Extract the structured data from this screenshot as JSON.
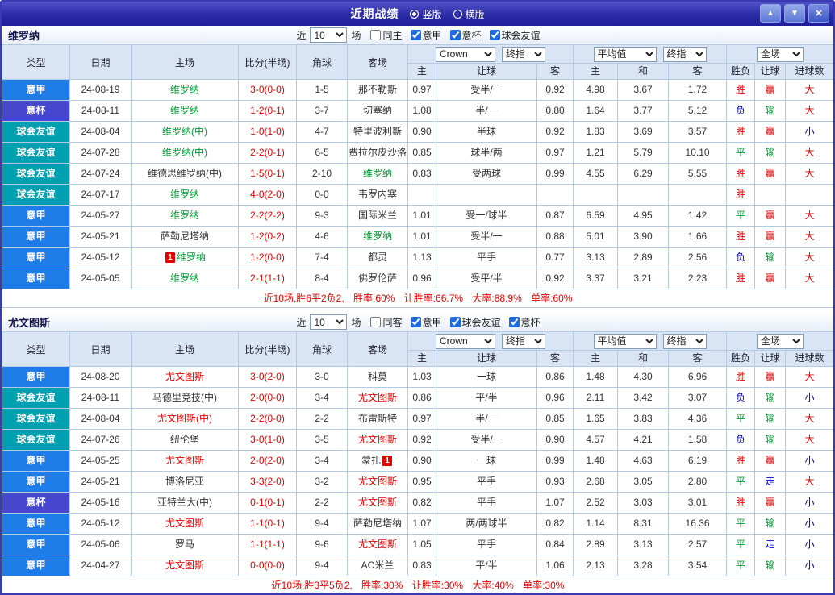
{
  "titlebar": {
    "title": "近期战绩",
    "radio_vertical": "竖版",
    "radio_horizontal": "横版"
  },
  "icons": {
    "up": "▲",
    "down": "▼",
    "close": "×"
  },
  "league_colors": {
    "意甲": "#1e7ce8",
    "意杯": "#4646cf",
    "球会友谊": "#00a0b0"
  },
  "result_colors": {
    "胜": "#e60000",
    "赢": "#e60000",
    "大": "#e60000",
    "平": "#009933",
    "输": "#009933",
    "负": "#0000cc",
    "走": "#0000cc",
    "小": "#0000cc"
  },
  "score_color": "#e60000",
  "header": {
    "near": "近",
    "count": "10",
    "matches": "场",
    "bookmaker_select": "Crown",
    "final_select_1": "终指",
    "average_select": "平均值",
    "final_select_2": "终指",
    "scope_select": "全场",
    "type": "类型",
    "date": "日期",
    "home": "主场",
    "score": "比分(半场)",
    "corner": "角球",
    "away": "客场",
    "odds_home": "主",
    "handicap": "让球",
    "odds_away": "客",
    "avg_home": "主",
    "avg_draw": "和",
    "avg_away": "客",
    "result": "胜负",
    "handicap_result": "让球",
    "goals": "进球数"
  },
  "sections": [
    {
      "team": "维罗纳",
      "subject_color": "#009933",
      "same_filter": "同主",
      "leagues": [
        "意甲",
        "意杯",
        "球会友谊"
      ],
      "rows": [
        {
          "type": "意甲",
          "date": "24-08-19",
          "home": "维罗纳",
          "home_subject": true,
          "away": "那不勒斯",
          "score": "3-0(0-0)",
          "corner": "1-5",
          "odds_home": "0.97",
          "handicap": "受半/一",
          "odds_away": "0.92",
          "avg_home": "4.98",
          "avg_draw": "3.67",
          "avg_away": "1.72",
          "result": "胜",
          "handicap_result": "赢",
          "goals": "大"
        },
        {
          "type": "意杯",
          "date": "24-08-11",
          "home": "维罗纳",
          "home_subject": true,
          "away": "切塞纳",
          "score": "1-2(0-1)",
          "corner": "3-7",
          "odds_home": "1.08",
          "handicap": "半/一",
          "odds_away": "0.80",
          "avg_home": "1.64",
          "avg_draw": "3.77",
          "avg_away": "5.12",
          "result": "负",
          "handicap_result": "输",
          "goals": "大"
        },
        {
          "type": "球会友谊",
          "date": "24-08-04",
          "home": "维罗纳(中)",
          "home_subject": true,
          "away": "特里波利斯",
          "score": "1-0(1-0)",
          "corner": "4-7",
          "odds_home": "0.90",
          "handicap": "半球",
          "odds_away": "0.92",
          "avg_home": "1.83",
          "avg_draw": "3.69",
          "avg_away": "3.57",
          "result": "胜",
          "handicap_result": "赢",
          "goals": "小"
        },
        {
          "type": "球会友谊",
          "date": "24-07-28",
          "home": "维罗纳(中)",
          "home_subject": true,
          "away": "费拉尔皮沙洛",
          "score": "2-2(0-1)",
          "corner": "6-5",
          "odds_home": "0.85",
          "handicap": "球半/两",
          "odds_away": "0.97",
          "avg_home": "1.21",
          "avg_draw": "5.79",
          "avg_away": "10.10",
          "result": "平",
          "handicap_result": "输",
          "goals": "大"
        },
        {
          "type": "球会友谊",
          "date": "24-07-24",
          "home": "维德思维罗纳(中)",
          "away": "维罗纳",
          "away_subject": true,
          "score": "1-5(0-1)",
          "corner": "2-10",
          "odds_home": "0.83",
          "handicap": "受两球",
          "odds_away": "0.99",
          "avg_home": "4.55",
          "avg_draw": "6.29",
          "avg_away": "5.55",
          "result": "胜",
          "handicap_result": "赢",
          "goals": "大"
        },
        {
          "type": "球会友谊",
          "date": "24-07-17",
          "home": "维罗纳",
          "home_subject": true,
          "away": "韦罗内塞",
          "score": "4-0(2-0)",
          "corner": "0-0",
          "odds_home": "",
          "handicap": "",
          "odds_away": "",
          "avg_home": "",
          "avg_draw": "",
          "avg_away": "",
          "result": "胜",
          "handicap_result": "",
          "goals": ""
        },
        {
          "type": "意甲",
          "date": "24-05-27",
          "home": "维罗纳",
          "home_subject": true,
          "away": "国际米兰",
          "score": "2-2(2-2)",
          "corner": "9-3",
          "odds_home": "1.01",
          "handicap": "受一/球半",
          "odds_away": "0.87",
          "avg_home": "6.59",
          "avg_draw": "4.95",
          "avg_away": "1.42",
          "result": "平",
          "handicap_result": "赢",
          "goals": "大"
        },
        {
          "type": "意甲",
          "date": "24-05-21",
          "home": "萨勒尼塔纳",
          "away": "维罗纳",
          "away_subject": true,
          "score": "1-2(0-2)",
          "corner": "4-6",
          "odds_home": "1.01",
          "handicap": "受半/一",
          "odds_away": "0.88",
          "avg_home": "5.01",
          "avg_draw": "3.90",
          "avg_away": "1.66",
          "result": "胜",
          "handicap_result": "赢",
          "goals": "大"
        },
        {
          "type": "意甲",
          "date": "24-05-12",
          "home": "维罗纳",
          "home_subject": true,
          "home_card": "1",
          "away": "都灵",
          "score": "1-2(0-0)",
          "corner": "7-4",
          "odds_home": "1.13",
          "handicap": "平手",
          "odds_away": "0.77",
          "avg_home": "3.13",
          "avg_draw": "2.89",
          "avg_away": "2.56",
          "result": "负",
          "handicap_result": "输",
          "goals": "大"
        },
        {
          "type": "意甲",
          "date": "24-05-05",
          "home": "维罗纳",
          "home_subject": true,
          "away": "佛罗伦萨",
          "score": "2-1(1-1)",
          "corner": "8-4",
          "odds_home": "0.96",
          "handicap": "受平/半",
          "odds_away": "0.92",
          "avg_home": "3.37",
          "avg_draw": "3.21",
          "avg_away": "2.23",
          "result": "胜",
          "handicap_result": "赢",
          "goals": "大"
        }
      ],
      "summary": "近10场,胜6平2负2, 胜率:60% 让胜率:66.7% 大率:88.9% 单率:60%"
    },
    {
      "team": "尤文图斯",
      "subject_color": "#e60000",
      "same_filter": "同客",
      "leagues": [
        "意甲",
        "球会友谊",
        "意杯"
      ],
      "rows": [
        {
          "type": "意甲",
          "date": "24-08-20",
          "home": "尤文图斯",
          "home_subject": true,
          "away": "科莫",
          "score": "3-0(2-0)",
          "corner": "3-0",
          "odds_home": "1.03",
          "handicap": "一球",
          "odds_away": "0.86",
          "avg_home": "1.48",
          "avg_draw": "4.30",
          "avg_away": "6.96",
          "result": "胜",
          "handicap_result": "赢",
          "goals": "大"
        },
        {
          "type": "球会友谊",
          "date": "24-08-11",
          "home": "马德里竞技(中)",
          "away": "尤文图斯",
          "away_subject": true,
          "score": "2-0(0-0)",
          "corner": "3-4",
          "odds_home": "0.86",
          "handicap": "平/半",
          "odds_away": "0.96",
          "avg_home": "2.11",
          "avg_draw": "3.42",
          "avg_away": "3.07",
          "result": "负",
          "handicap_result": "输",
          "goals": "小"
        },
        {
          "type": "球会友谊",
          "date": "24-08-04",
          "home": "尤文图斯(中)",
          "home_subject": true,
          "away": "布雷斯特",
          "score": "2-2(0-0)",
          "corner": "2-2",
          "odds_home": "0.97",
          "handicap": "半/一",
          "odds_away": "0.85",
          "avg_home": "1.65",
          "avg_draw": "3.83",
          "avg_away": "4.36",
          "result": "平",
          "handicap_result": "输",
          "goals": "大"
        },
        {
          "type": "球会友谊",
          "date": "24-07-26",
          "home": "纽伦堡",
          "away": "尤文图斯",
          "away_subject": true,
          "score": "3-0(1-0)",
          "corner": "3-5",
          "odds_home": "0.92",
          "handicap": "受半/一",
          "odds_away": "0.90",
          "avg_home": "4.57",
          "avg_draw": "4.21",
          "avg_away": "1.58",
          "result": "负",
          "handicap_result": "输",
          "goals": "大"
        },
        {
          "type": "意甲",
          "date": "24-05-25",
          "home": "尤文图斯",
          "home_subject": true,
          "away": "蒙扎",
          "away_card": "1",
          "score": "2-0(2-0)",
          "corner": "3-4",
          "odds_home": "0.90",
          "handicap": "一球",
          "odds_away": "0.99",
          "avg_home": "1.48",
          "avg_draw": "4.63",
          "avg_away": "6.19",
          "result": "胜",
          "handicap_result": "赢",
          "goals": "小"
        },
        {
          "type": "意甲",
          "date": "24-05-21",
          "home": "博洛尼亚",
          "away": "尤文图斯",
          "away_subject": true,
          "score": "3-3(2-0)",
          "corner": "3-2",
          "odds_home": "0.95",
          "handicap": "平手",
          "odds_away": "0.93",
          "avg_home": "2.68",
          "avg_draw": "3.05",
          "avg_away": "2.80",
          "result": "平",
          "handicap_result": "走",
          "goals": "大"
        },
        {
          "type": "意杯",
          "date": "24-05-16",
          "home": "亚特兰大(中)",
          "away": "尤文图斯",
          "away_subject": true,
          "score": "0-1(0-1)",
          "corner": "2-2",
          "odds_home": "0.82",
          "handicap": "平手",
          "odds_away": "1.07",
          "avg_home": "2.52",
          "avg_draw": "3.03",
          "avg_away": "3.01",
          "result": "胜",
          "handicap_result": "赢",
          "goals": "小"
        },
        {
          "type": "意甲",
          "date": "24-05-12",
          "home": "尤文图斯",
          "home_subject": true,
          "away": "萨勒尼塔纳",
          "score": "1-1(0-1)",
          "corner": "9-4",
          "odds_home": "1.07",
          "handicap": "两/两球半",
          "odds_away": "0.82",
          "avg_home": "1.14",
          "avg_draw": "8.31",
          "avg_away": "16.36",
          "result": "平",
          "handicap_result": "输",
          "goals": "小"
        },
        {
          "type": "意甲",
          "date": "24-05-06",
          "home": "罗马",
          "away": "尤文图斯",
          "away_subject": true,
          "score": "1-1(1-1)",
          "corner": "9-6",
          "odds_home": "1.05",
          "handicap": "平手",
          "odds_away": "0.84",
          "avg_home": "2.89",
          "avg_draw": "3.13",
          "avg_away": "2.57",
          "result": "平",
          "handicap_result": "走",
          "goals": "小"
        },
        {
          "type": "意甲",
          "date": "24-04-27",
          "home": "尤文图斯",
          "home_subject": true,
          "away": "AC米兰",
          "score": "0-0(0-0)",
          "corner": "9-4",
          "odds_home": "0.83",
          "handicap": "平/半",
          "odds_away": "1.06",
          "avg_home": "2.13",
          "avg_draw": "3.28",
          "avg_away": "3.54",
          "result": "平",
          "handicap_result": "输",
          "goals": "小"
        }
      ],
      "summary": "近10场,胜3平5负2, 胜率:30% 让胜率:30% 大率:40% 单率:30%"
    }
  ]
}
